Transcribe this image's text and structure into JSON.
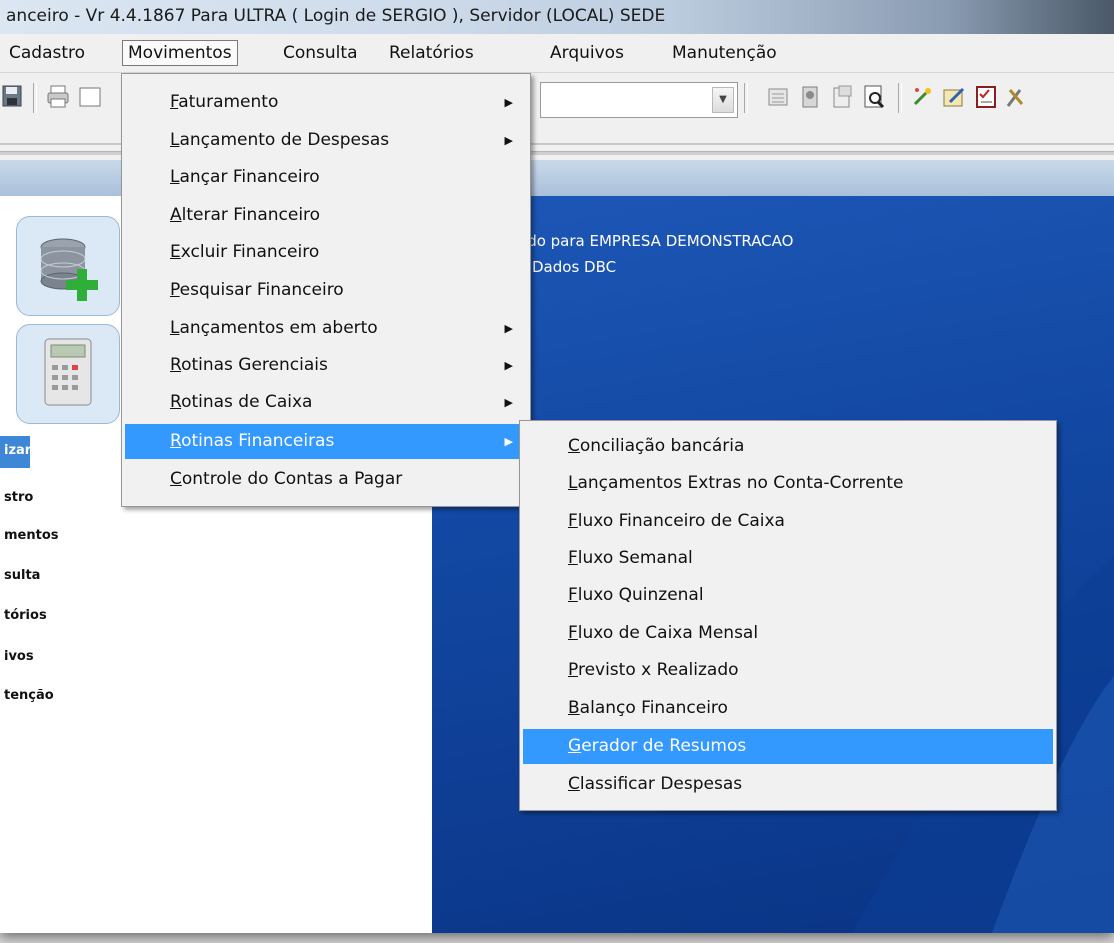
{
  "window": {
    "title": "anceiro - Vr 4.4.1867 Para ULTRA  ( Login de SERGIO ), Servidor (LOCAL) SEDE"
  },
  "menubar": {
    "items": [
      "Cadastro",
      "Movimentos",
      "Consulta",
      "Relatórios",
      "Arquivos",
      "Manutenção"
    ],
    "active": "Movimentos"
  },
  "toolbar": {
    "icons": [
      "save-icon",
      "print-icon",
      "calendar-icon",
      "satellite-icon",
      "properties-icon",
      "preview-icon",
      "wand-icon",
      "edit-icon",
      "checklist-icon",
      "tools-icon"
    ],
    "combo_value": ""
  },
  "sidebar": {
    "big_icons": [
      "database-add-icon",
      "calculator-icon"
    ],
    "items": [
      "izar",
      "stro",
      "mentos",
      "sulta",
      "tórios",
      "ivos",
      "tenção"
    ],
    "active_index": 0
  },
  "desktop": {
    "line1": "ado para EMPRESA DEMONSTRACAO",
    "line2": "e Dados DBC"
  },
  "movimentos_menu": {
    "items": [
      {
        "first": "F",
        "rest": "aturamento",
        "submenu": true
      },
      {
        "first": "L",
        "rest": "ançamento de Despesas",
        "submenu": true
      },
      {
        "first": "L",
        "rest": "ançar Financeiro",
        "submenu": false
      },
      {
        "first": "A",
        "rest": "lterar Financeiro",
        "submenu": false
      },
      {
        "first": "E",
        "rest": "xcluir Financeiro",
        "submenu": false
      },
      {
        "first": "P",
        "rest": "esquisar Financeiro",
        "submenu": false
      },
      {
        "first": "L",
        "rest": "ançamentos em aberto",
        "submenu": true
      },
      {
        "first": "R",
        "rest": "otinas Gerenciais",
        "submenu": true
      },
      {
        "first": "R",
        "rest": "otinas de Caixa",
        "submenu": true
      },
      {
        "first": "R",
        "rest": "otinas Financeiras",
        "submenu": true,
        "highlighted": true
      },
      {
        "first": "C",
        "rest": "ontrole do Contas a Pagar",
        "submenu": false
      }
    ]
  },
  "rotinas_financeiras_menu": {
    "items": [
      {
        "first": "C",
        "rest": "onciliação bancária"
      },
      {
        "first": "L",
        "rest": "ançamentos Extras no Conta-Corrente"
      },
      {
        "first": "F",
        "rest": "luxo Financeiro de Caixa"
      },
      {
        "first": "F",
        "rest": "luxo Semanal"
      },
      {
        "first": "F",
        "rest": "luxo Quinzenal"
      },
      {
        "first": "F",
        "rest": "luxo de Caixa Mensal"
      },
      {
        "first": "P",
        "rest": "revisto x Realizado"
      },
      {
        "first": "B",
        "rest": "alanço Financeiro"
      },
      {
        "first": "G",
        "rest": "erador de Resumos",
        "highlighted": true
      },
      {
        "first": "C",
        "rest": "lassificar Despesas"
      }
    ]
  },
  "colors": {
    "highlight": "#3399ff",
    "desktop": "#1248a3"
  }
}
